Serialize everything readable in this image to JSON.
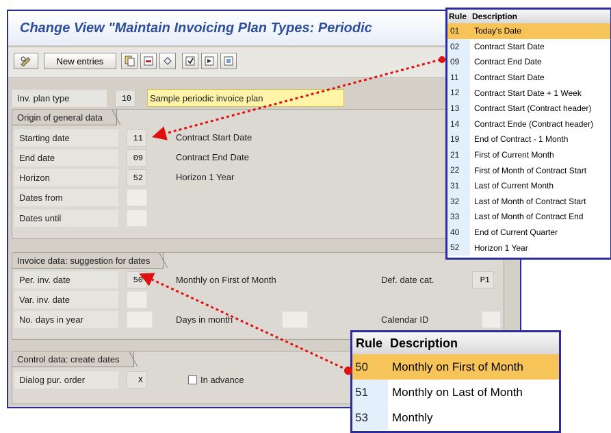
{
  "window": {
    "title": "Change View \"Maintain Invoicing Plan Types: Periodic",
    "toolbar": {
      "new_entries_label": "New entries"
    }
  },
  "header": {
    "inv_plan_type_label": "Inv. plan type",
    "inv_plan_type_value": "10",
    "description_value": "Sample periodic invoice plan"
  },
  "origin": {
    "group_title": "Origin of general data",
    "starting_date_label": "Starting date",
    "starting_date_value": "11",
    "starting_date_text": "Contract Start Date",
    "end_date_label": "End date",
    "end_date_value": "09",
    "end_date_text": "Contract End Date",
    "horizon_label": "Horizon",
    "horizon_value": "52",
    "horizon_text": "Horizon 1 Year",
    "dates_from_label": "Dates from",
    "dates_until_label": "Dates until"
  },
  "invoice": {
    "group_title": "Invoice data: suggestion for dates",
    "per_inv_date_label": "Per. inv. date",
    "per_inv_date_value": "50",
    "per_inv_date_text": "Monthly on First of Month",
    "def_date_cat_label": "Def. date cat.",
    "def_date_cat_value": "P1",
    "var_inv_date_label": "Var. inv. date",
    "no_days_label": "No. days in year",
    "days_in_month_label": "Days in month",
    "calendar_id_label": "Calendar ID"
  },
  "control": {
    "group_title": "Control data: create dates",
    "dialog_label": "Dialog pur. order",
    "dialog_value": "X",
    "in_advance_label": "In advance"
  },
  "popup_top": {
    "col_rule": "Rule",
    "col_desc": "Description",
    "rows": [
      {
        "rule": "01",
        "desc": "Today's Date",
        "selected": true
      },
      {
        "rule": "02",
        "desc": "Contract Start Date"
      },
      {
        "rule": "09",
        "desc": "Contract End Date"
      },
      {
        "rule": "11",
        "desc": "Contract Start Date"
      },
      {
        "rule": "12",
        "desc": "Contract Start Date + 1 Week"
      },
      {
        "rule": "13",
        "desc": "Contract Start (Contract header)"
      },
      {
        "rule": "14",
        "desc": "Contract Ende (Contract header)"
      },
      {
        "rule": "19",
        "desc": "End of Contract - 1 Month"
      },
      {
        "rule": "21",
        "desc": "First of Current Month"
      },
      {
        "rule": "22",
        "desc": "First of Month of Contract Start"
      },
      {
        "rule": "31",
        "desc": "Last of Current Month"
      },
      {
        "rule": "32",
        "desc": "Last of Month of Contract Start"
      },
      {
        "rule": "33",
        "desc": "Last of Month of Contract End"
      },
      {
        "rule": "40",
        "desc": "End of Current Quarter"
      },
      {
        "rule": "52",
        "desc": "Horizon 1 Year"
      }
    ]
  },
  "popup_bottom": {
    "col_rule": "Rule",
    "col_desc": "Description",
    "rows": [
      {
        "rule": "50",
        "desc": "Monthly on First of Month",
        "selected": true
      },
      {
        "rule": "51",
        "desc": "Monthly on Last of Month"
      },
      {
        "rule": "53",
        "desc": "Monthly"
      }
    ]
  },
  "colors": {
    "accent_title": "#2e4f9b",
    "popup_border": "#2b2b9e",
    "selection": "#f7c45a",
    "arrow": "#e01010"
  }
}
